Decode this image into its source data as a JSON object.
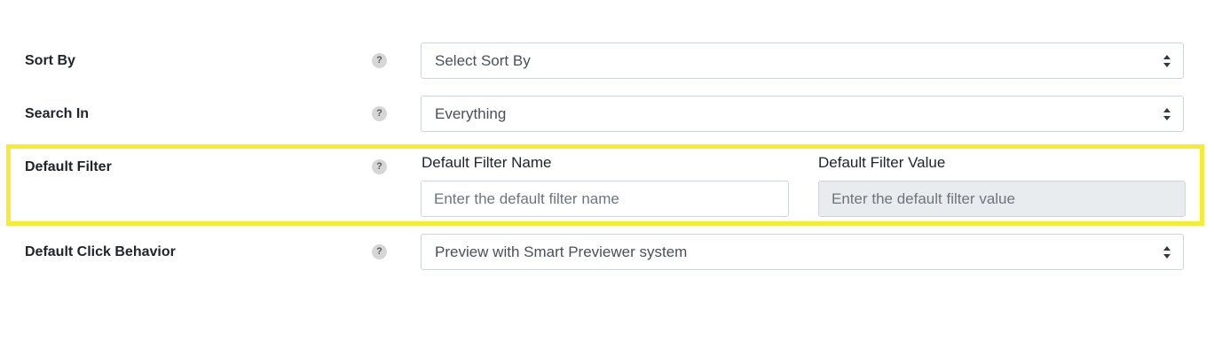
{
  "fields": {
    "sort_by": {
      "label": "Sort By",
      "help": "?",
      "selected": "Select Sort By"
    },
    "search_in": {
      "label": "Search In",
      "help": "?",
      "selected": "Everything"
    },
    "default_filter": {
      "label": "Default Filter",
      "help": "?",
      "name_label": "Default Filter Name",
      "name_placeholder": "Enter the default filter name",
      "value_label": "Default Filter Value",
      "value_placeholder": "Enter the default filter value"
    },
    "default_click_behavior": {
      "label": "Default Click Behavior",
      "help": "?",
      "selected": "Preview with Smart Previewer system"
    }
  },
  "colors": {
    "highlight": "#f5ec38",
    "border": "#ced4da",
    "disabled_bg": "#e9ecef"
  }
}
